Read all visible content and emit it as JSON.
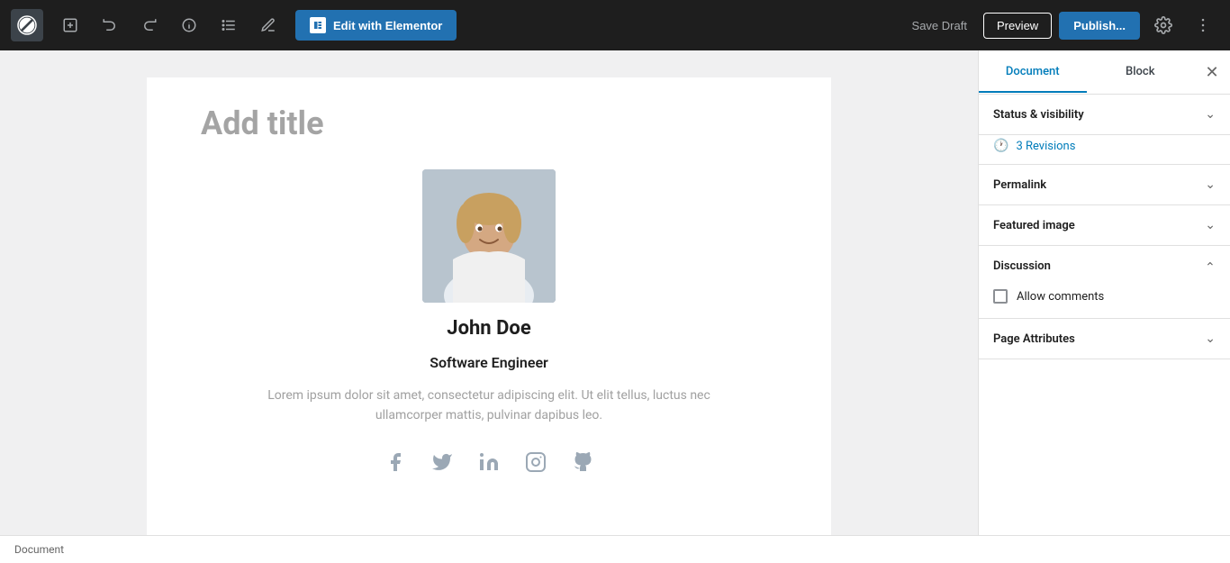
{
  "toolbar": {
    "elementor_button": "Edit with Elementor",
    "save_draft": "Save Draft",
    "preview": "Preview",
    "publish": "Publish...",
    "tabs": {
      "document": "Document",
      "block": "Block"
    }
  },
  "editor": {
    "page_title": "Add title",
    "profile": {
      "name": "John Doe",
      "job_title": "Software Engineer",
      "bio": "Lorem ipsum dolor sit amet, consectetur adipiscing elit. Ut elit tellus, luctus nec ullamcorper mattis, pulvinar dapibus leo."
    }
  },
  "sidebar": {
    "sections": {
      "status_visibility": {
        "title": "Status & visibility",
        "expanded": false
      },
      "revisions": {
        "label": "3 Revisions",
        "count": 3
      },
      "permalink": {
        "title": "Permalink",
        "expanded": false
      },
      "featured_image": {
        "title": "Featured image",
        "expanded": false
      },
      "discussion": {
        "title": "Discussion",
        "expanded": true,
        "allow_comments_label": "Allow comments"
      },
      "page_attributes": {
        "title": "Page Attributes",
        "expanded": false
      }
    }
  },
  "status_bar": {
    "text": "Document"
  }
}
